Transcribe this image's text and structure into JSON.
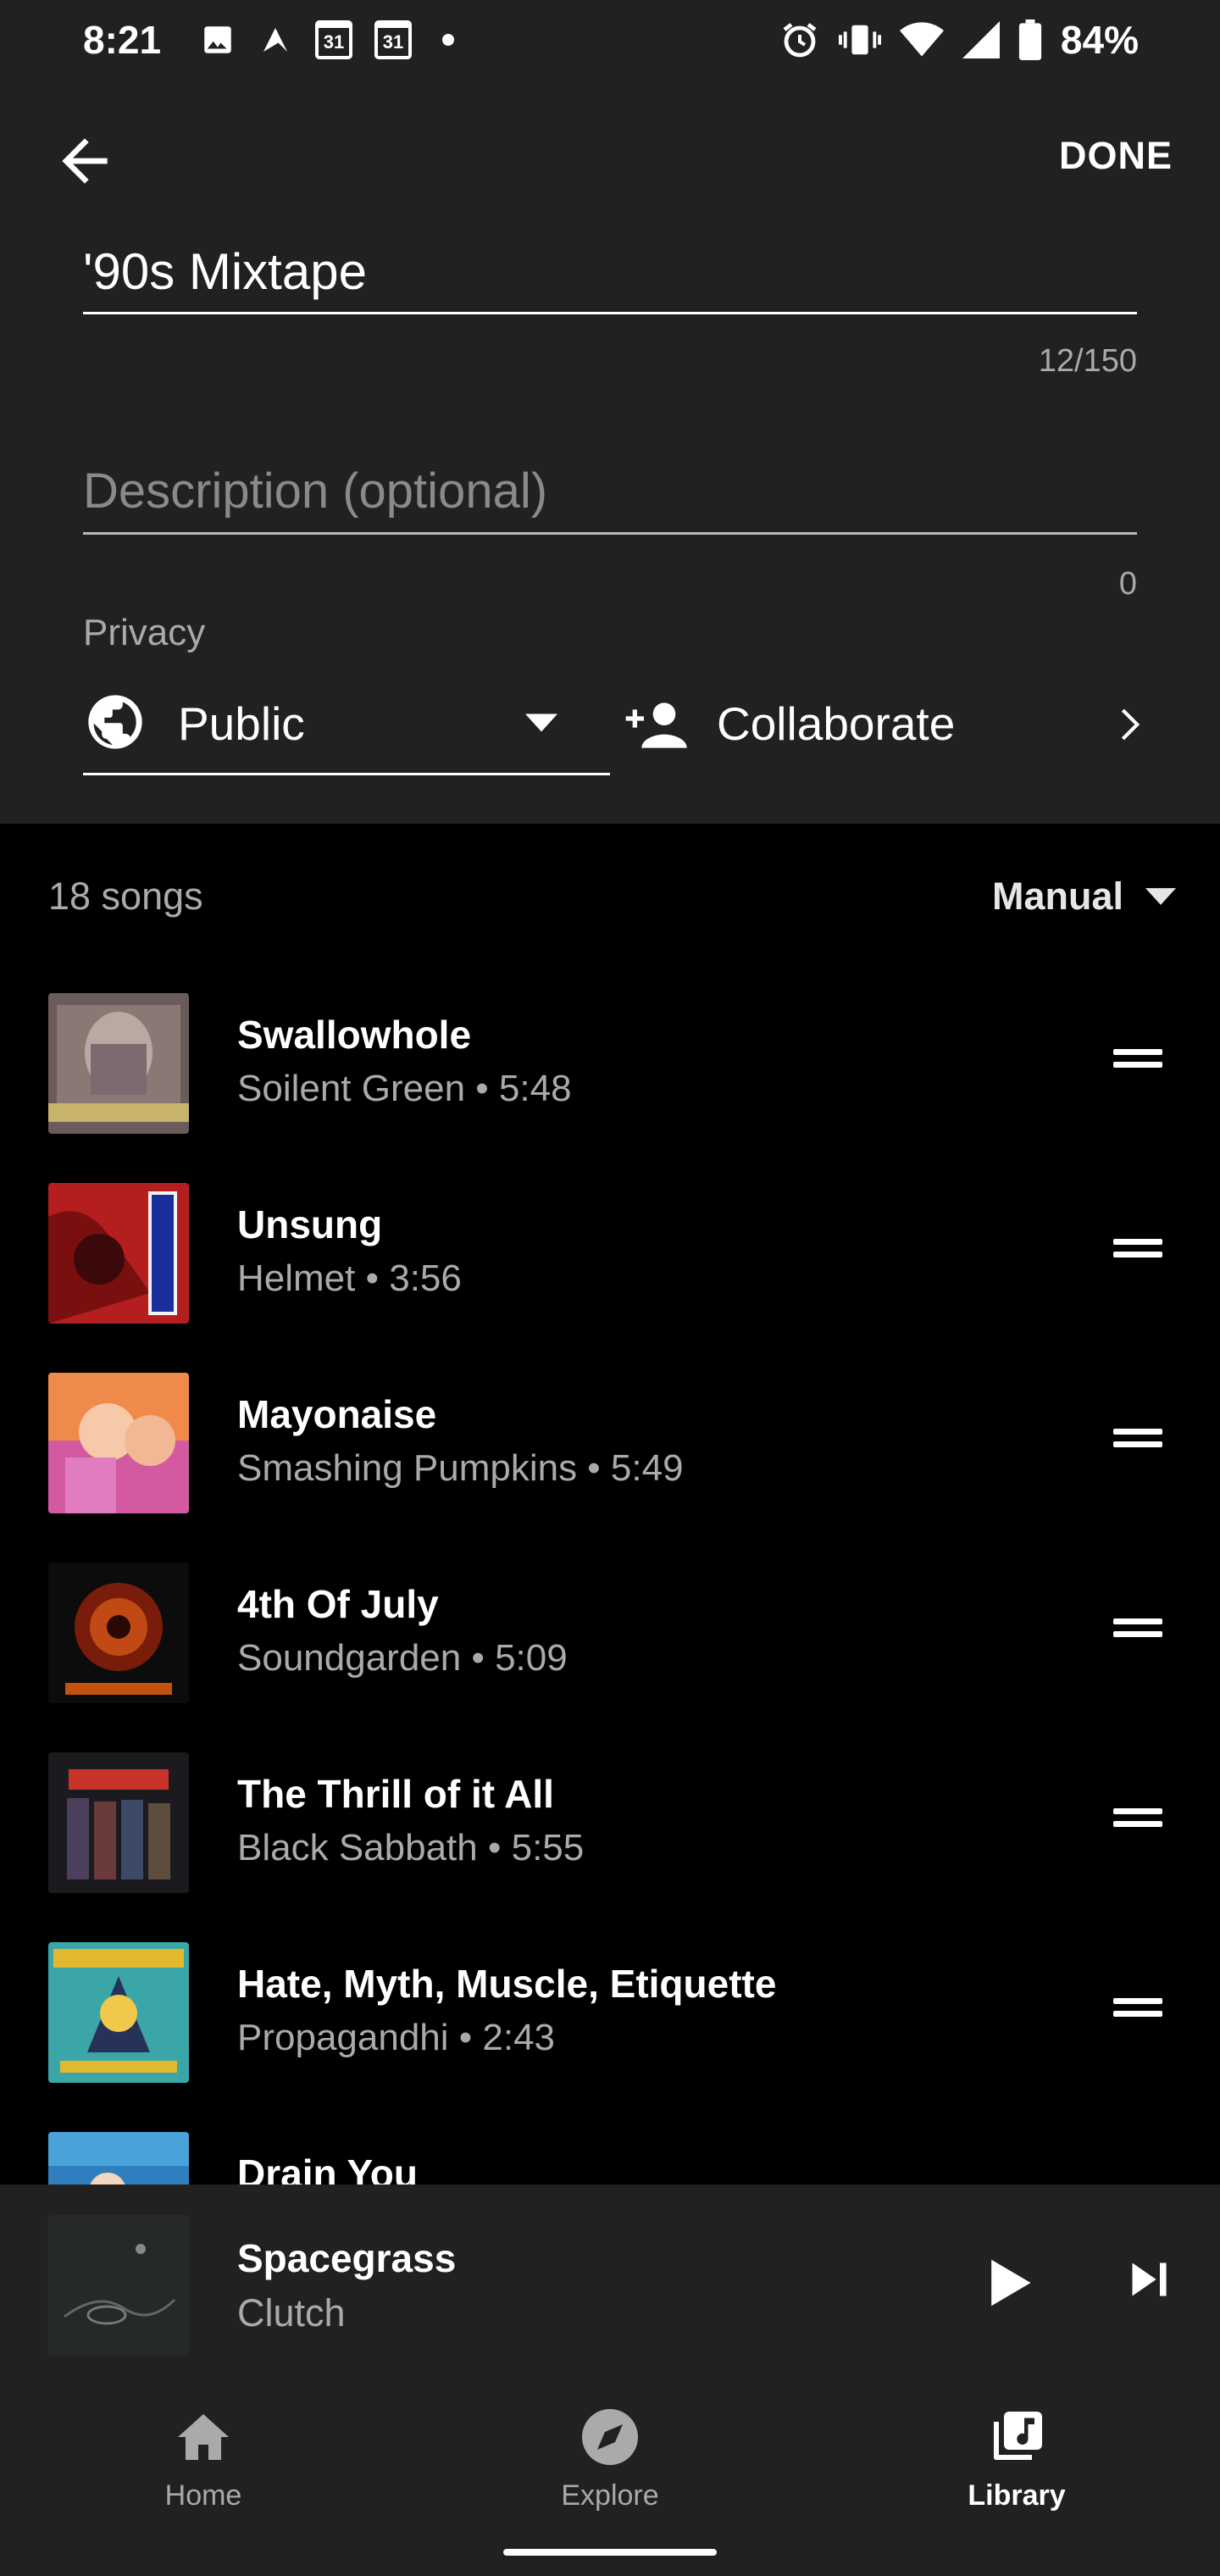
{
  "status_bar": {
    "time": "8:21",
    "battery": "84%"
  },
  "header": {
    "back_icon": "arrow-back-icon",
    "done_label": "DONE"
  },
  "form": {
    "title_value": "'90s Mixtape",
    "title_counter": "12/150",
    "description_placeholder": "Description (optional)",
    "description_counter": "0",
    "privacy_label": "Privacy",
    "privacy_value": "Public",
    "collaborate_label": "Collaborate"
  },
  "songs_header": {
    "count_label": "18 songs",
    "sort_label": "Manual"
  },
  "songs": [
    {
      "title": "Swallowhole",
      "subtitle": "Soilent Green • 5:48"
    },
    {
      "title": "Unsung",
      "subtitle": "Helmet • 3:56"
    },
    {
      "title": "Mayonaise",
      "subtitle": "Smashing Pumpkins • 5:49"
    },
    {
      "title": "4th Of July",
      "subtitle": "Soundgarden • 5:09"
    },
    {
      "title": "The Thrill of it All",
      "subtitle": "Black Sabbath • 5:55"
    },
    {
      "title": "Hate, Myth, Muscle, Etiquette",
      "subtitle": "Propagandhi • 2:43"
    },
    {
      "title": "Drain You",
      "subtitle": ""
    }
  ],
  "now_playing": {
    "title": "Spacegrass",
    "artist": "Clutch"
  },
  "nav": {
    "home": "Home",
    "explore": "Explore",
    "library": "Library"
  },
  "colors": {
    "panel": "#212121",
    "background": "#000000",
    "secondary_text": "#aaaaaa"
  }
}
